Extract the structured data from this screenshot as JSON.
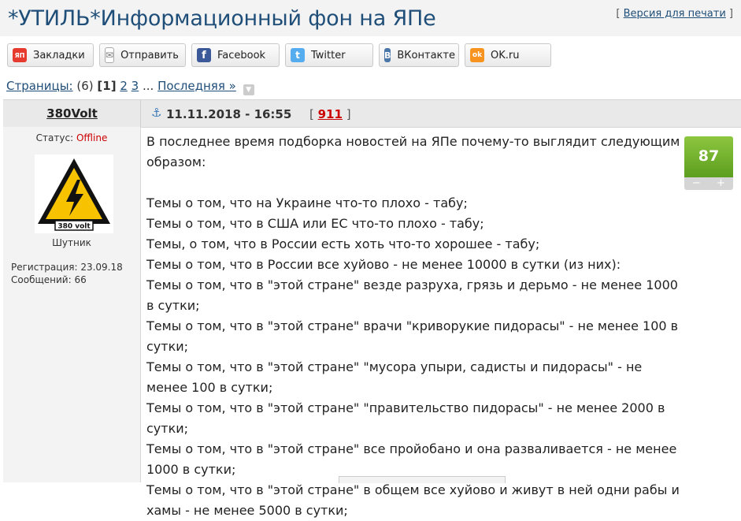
{
  "header": {
    "title": "*УТИЛЬ*Информационный фон на ЯПе",
    "print_prefix": "[ ",
    "print_link": "Версия для печати",
    "print_suffix": " ]"
  },
  "share": [
    {
      "label": "Закладки",
      "icon": "yap-icon",
      "icon_text": "ЯП",
      "color": "#e63a2e"
    },
    {
      "label": "Отправить",
      "icon": "mail-icon",
      "icon_text": "✉",
      "color": "#8a8a8a"
    },
    {
      "label": "Facebook",
      "icon": "facebook-icon",
      "icon_text": "f",
      "color": "#3b5998"
    },
    {
      "label": "Twitter",
      "icon": "twitter-icon",
      "icon_text": "t",
      "color": "#55acee"
    },
    {
      "label": "ВКонтакте",
      "icon": "vk-icon",
      "icon_text": "B",
      "color": "#4a76a8"
    },
    {
      "label": "OK.ru",
      "icon": "ok-icon",
      "icon_text": "ok",
      "color": "#f7931e"
    }
  ],
  "pager": {
    "label": "Страницы:",
    "count": "(6)",
    "current": "[1]",
    "p2": "2",
    "p3": "3",
    "ellipsis": "...",
    "last": "Последняя »"
  },
  "post": {
    "author": "380Volt",
    "date": "11.11.2018 - 16:55",
    "number_prefix": "[ ",
    "number": "911",
    "number_suffix": " ]",
    "status_label": "Статус: ",
    "status_value": "Offline",
    "avatar_text": "380 volt",
    "rank": "Шутник",
    "registration": "Регистрация: 23.09.18",
    "messages": "Сообщений: 66",
    "rating": "87",
    "rating_minus": "−",
    "rating_plus": "+",
    "lines": [
      "В последнее время подборка новостей на ЯПе почему-то выглядит следующим образом:",
      "",
      "Темы о том, что на Украине что-то плохо - табу;",
      "Темы о том, что в США или ЕС что-то плохо - табу;",
      "Темы, о том, что в России есть хоть что-то хорошее - табу;",
      "Темы о том, что в России все хуйово - не менее 10000 в сутки (из них):",
      "Темы о том, что в \"этой стране\" везде разруха, грязь и дерьмо - не менее 1000 в сутки;",
      "Темы о том, что в \"этой стране\" врачи \"криворукие пидорасы\" - не менее 100 в сутки;",
      "Темы о том, что в \"этой стране\" \"мусора упыри, садисты и пидорасы\" - не менее 100 в сутки;",
      "Темы о том, что в \"этой стране\" \"правительство пидорасы\" - не менее 2000 в сутки;",
      "Темы о том, что в \"этой стране\" все пройобано и она разваливается - не менее 1000 в сутки;",
      "Темы о том, что в \"этой стране\" в общем все хуйово и живут в ней одни рабы и хамы - не менее 5000 в сутки;"
    ]
  }
}
